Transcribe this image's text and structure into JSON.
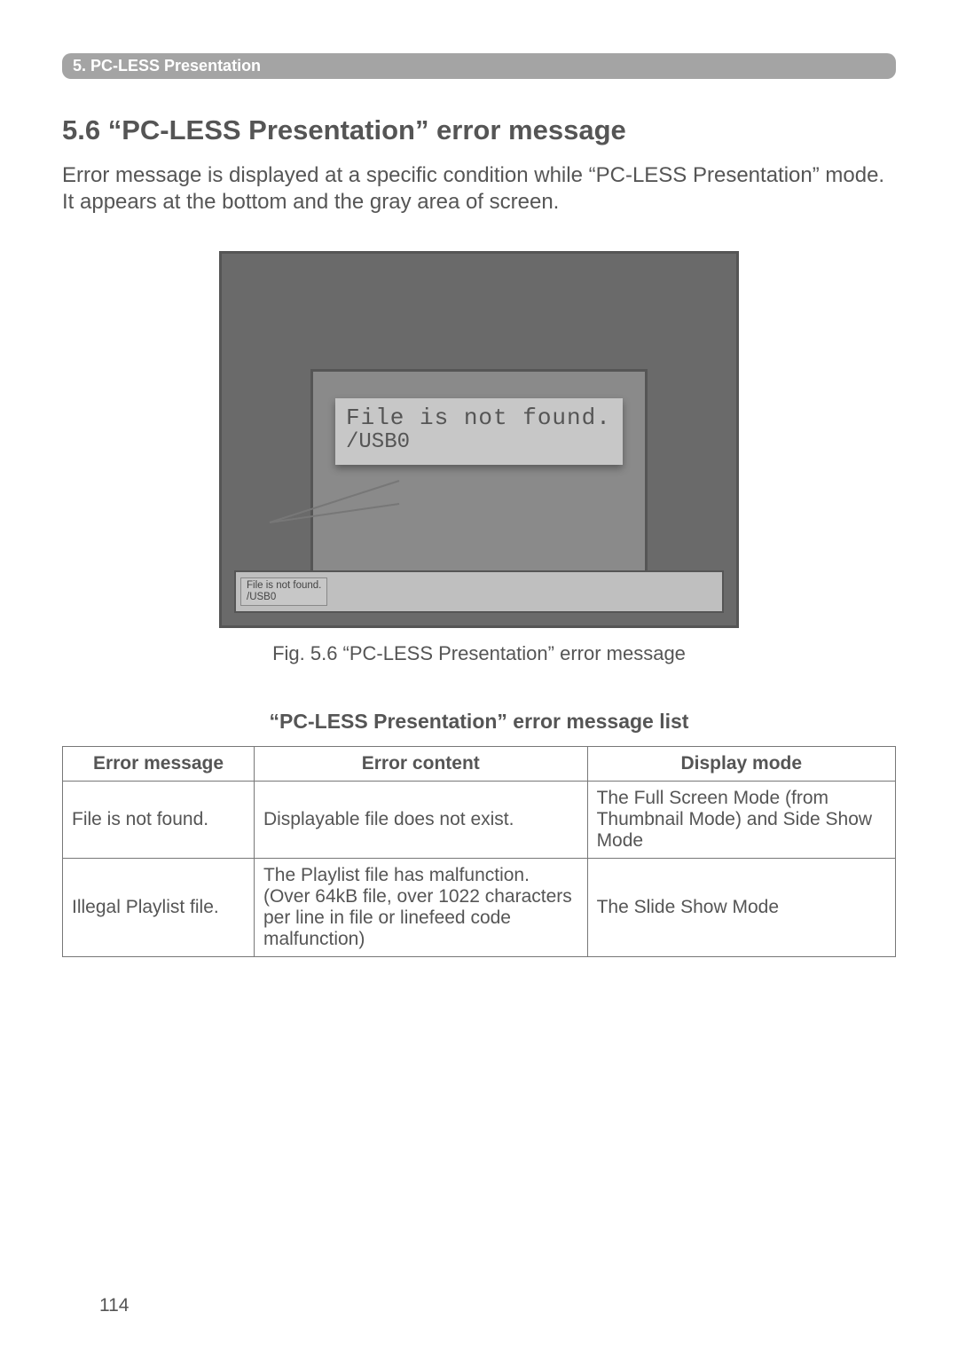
{
  "banner": {
    "label": "5. PC-LESS Presentation"
  },
  "section": {
    "title": "5.6 “PC-LESS Presentation” error message"
  },
  "intro": "Error message is displayed at a specific condition while “PC-LESS Presentation” mode. It appears at the bottom and the gray area of screen.",
  "figure": {
    "dialog_line1": "File is not found.",
    "dialog_line2": "/USB0",
    "footer_line1": "File is not found.",
    "footer_line2": "/USB0",
    "caption": "Fig. 5.6 “PC-LESS Presentation” error message"
  },
  "table": {
    "title": "“PC-LESS Presentation” error message list",
    "headers": {
      "msg": "Error message",
      "content": "Error content",
      "mode": "Display mode"
    },
    "rows": [
      {
        "msg": "File is not found.",
        "content": "Displayable file does not exist.",
        "mode": "The Full Screen Mode (from Thumbnail Mode) and Side Show Mode"
      },
      {
        "msg": "Illegal Playlist file.",
        "content": "The Playlist file has malfunction. (Over 64kB file, over 1022 characters per line in file or linefeed code malfunction)",
        "mode": "The Slide Show Mode"
      }
    ]
  },
  "page_number": "114"
}
